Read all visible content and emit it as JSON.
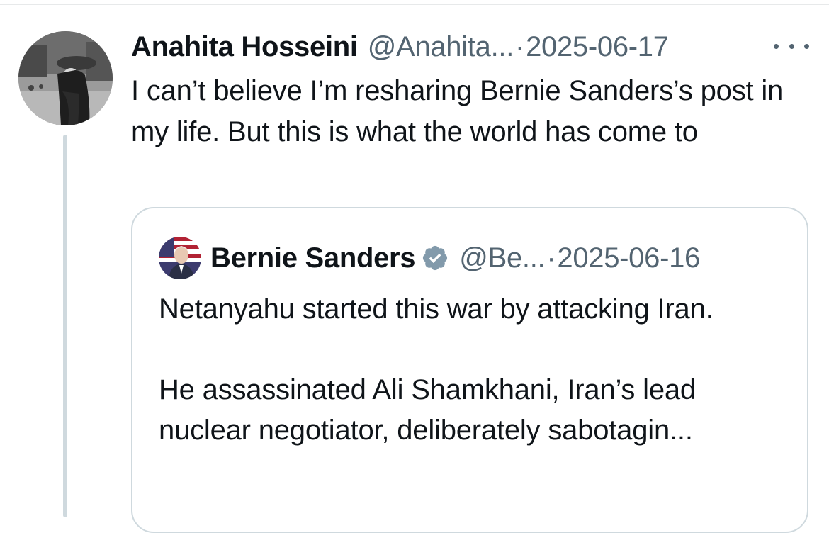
{
  "tweet": {
    "author_name": "Anahita Hosseini",
    "author_handle": "@Anahita...",
    "separator": "·",
    "date": "2025-06-17",
    "text": "I can’t believe I’m resharing Bernie Sanders’s post in my life. But this is what the world has come to",
    "avatar_icon": "profile-photo-grayscale",
    "more_icon": "more-horizontal-icon"
  },
  "quote": {
    "author_name": "Bernie Sanders",
    "verified_icon": "verified-badge-icon",
    "author_handle": "@Be...",
    "separator": "·",
    "date": "2025-06-16",
    "text": "Netanyahu started this war by attacking Iran.\n\nHe assassinated Ali Shamkhani, Iran’s lead nuclear negotiator, deliberately sabotagin..."
  },
  "colors": {
    "text_primary": "#0f1419",
    "text_secondary": "#536471",
    "border": "#cfd9de",
    "verified_badge": "#829aab"
  }
}
